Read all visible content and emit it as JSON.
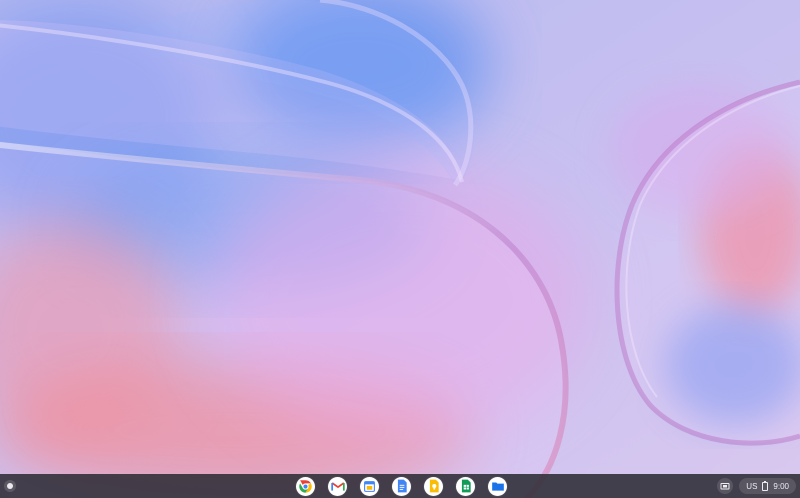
{
  "wallpaper": {
    "colors": {
      "background": "#c7bdf0",
      "blue": "#4f8df0",
      "coral": "#f57a7a",
      "pink": "#e69ad6",
      "lilac": "#d7b9f0"
    }
  },
  "shelf": {
    "apps": [
      {
        "name": "chrome-icon"
      },
      {
        "name": "gmail-icon"
      },
      {
        "name": "google-calendar-icon"
      },
      {
        "name": "google-docs-icon"
      },
      {
        "name": "google-keep-icon"
      },
      {
        "name": "google-sheets-icon"
      },
      {
        "name": "files-icon"
      }
    ],
    "status": {
      "input_method": "US",
      "time": "9:00"
    }
  }
}
